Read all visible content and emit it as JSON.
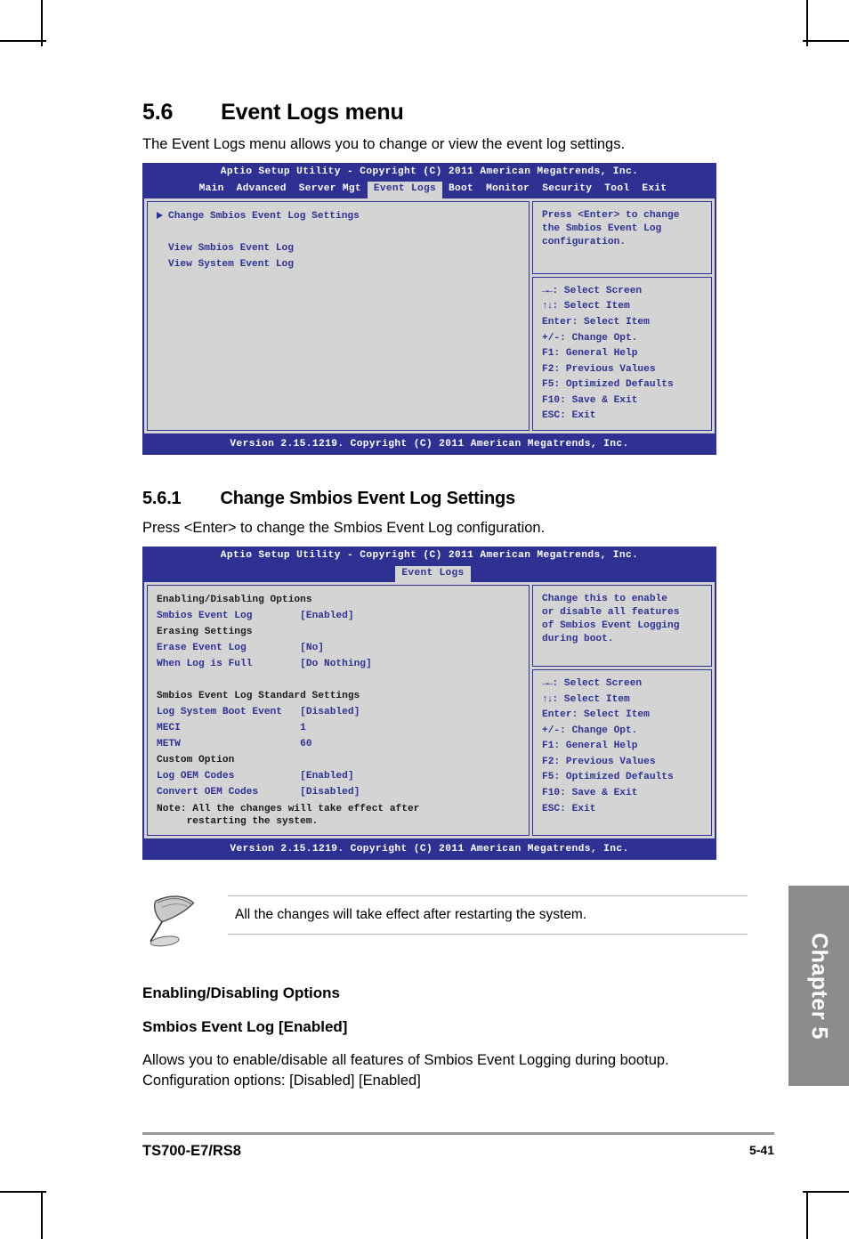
{
  "document": {
    "section": {
      "number": "5.6",
      "title": "Event Logs menu"
    },
    "section_intro": "The Event Logs menu allows you to change or view the event log settings.",
    "subsection": {
      "number": "5.6.1",
      "title": "Change Smbios Event Log Settings"
    },
    "subsection_intro": "Press <Enter> to change the Smbios Event Log configuration.",
    "note_callout": "All the changes will take effect after restarting the system.",
    "lower": {
      "group_heading": "Enabling/Disabling Options",
      "item_heading": "Smbios Event Log [Enabled]",
      "item_body": "Allows you  to enable/disable all features of Smbios Event Logging during bootup. Configuration options: [Disabled] [Enabled]"
    },
    "footer": {
      "model": "TS700-E7/RS8",
      "page": "5-41"
    },
    "chapter_tab": "Chapter 5",
    "colors": {
      "bios_blue": "#2e3192",
      "bios_gray": "#d4d4d4",
      "chapter_gray": "#8c8c8c"
    }
  },
  "bios1": {
    "title": "Aptio Setup Utility - Copyright (C) 2011 American Megatrends, Inc.",
    "tabs": [
      {
        "label": "Main",
        "active": false
      },
      {
        "label": "Advanced",
        "active": false
      },
      {
        "label": "Server Mgt",
        "active": false
      },
      {
        "label": "Event Logs",
        "active": true
      },
      {
        "label": "Boot",
        "active": false
      },
      {
        "label": "Monitor",
        "active": false
      },
      {
        "label": "Security",
        "active": false
      },
      {
        "label": "Tool",
        "active": false
      },
      {
        "label": "Exit",
        "active": false
      }
    ],
    "items": [
      {
        "type": "submenu",
        "label": "Change Smbios Event Log Settings"
      },
      {
        "type": "spacer",
        "label": ""
      },
      {
        "type": "link",
        "label": "View Smbios Event Log"
      },
      {
        "type": "link",
        "label": "View System Event Log"
      }
    ],
    "help": "Press <Enter> to change\nthe Smbios Event Log\nconfiguration.",
    "legend": [
      {
        "keys": "→←",
        "text": ": Select Screen"
      },
      {
        "keys": "↑↓",
        "text": ": Select Item"
      },
      {
        "keys": "",
        "text": "Enter: Select Item"
      },
      {
        "keys": "",
        "text": "+/-: Change Opt."
      },
      {
        "keys": "",
        "text": "F1: General Help"
      },
      {
        "keys": "",
        "text": "F2: Previous Values"
      },
      {
        "keys": "",
        "text": "F5: Optimized Defaults"
      },
      {
        "keys": "",
        "text": "F10: Save & Exit"
      },
      {
        "keys": "",
        "text": "ESC: Exit"
      }
    ],
    "footer": "Version 2.15.1219. Copyright (C) 2011 American Megatrends, Inc."
  },
  "bios2": {
    "title": "Aptio Setup Utility - Copyright (C) 2011 American Megatrends, Inc.",
    "tabs": [
      {
        "label": "Event Logs",
        "active": true
      }
    ],
    "items": [
      {
        "type": "group",
        "label": "Enabling/Disabling Options",
        "value": ""
      },
      {
        "type": "option",
        "label": "Smbios Event Log",
        "value": "[Enabled]"
      },
      {
        "type": "group",
        "label": "Erasing Settings",
        "value": ""
      },
      {
        "type": "option",
        "label": "Erase Event Log",
        "value": "[No]"
      },
      {
        "type": "option",
        "label": "When Log is Full",
        "value": "[Do Nothing]"
      },
      {
        "type": "spacer",
        "label": "",
        "value": ""
      },
      {
        "type": "group",
        "label": "Smbios Event Log Standard Settings",
        "value": ""
      },
      {
        "type": "option",
        "label": "Log System Boot Event",
        "value": "[Disabled]"
      },
      {
        "type": "option",
        "label": "MECI",
        "value": "1"
      },
      {
        "type": "option",
        "label": "METW",
        "value": "60"
      },
      {
        "type": "group",
        "label": "Custom Option",
        "value": ""
      },
      {
        "type": "option",
        "label": "Log OEM Codes",
        "value": "[Enabled]"
      },
      {
        "type": "option",
        "label": "Convert OEM Codes",
        "value": "[Disabled]"
      }
    ],
    "note": "Note: All the changes will take effect after\n     restarting the system.",
    "help": "Change this to enable\nor disable all features\nof Smbios Event Logging\nduring boot.",
    "legend": [
      {
        "keys": "→←",
        "text": ": Select Screen"
      },
      {
        "keys": "↑↓",
        "text": ": Select Item"
      },
      {
        "keys": "",
        "text": "Enter: Select Item"
      },
      {
        "keys": "",
        "text": "+/-: Change Opt."
      },
      {
        "keys": "",
        "text": "F1: General Help"
      },
      {
        "keys": "",
        "text": "F2: Previous Values"
      },
      {
        "keys": "",
        "text": "F5: Optimized Defaults"
      },
      {
        "keys": "",
        "text": "F10: Save & Exit"
      },
      {
        "keys": "",
        "text": "ESC: Exit"
      }
    ],
    "footer": "Version 2.15.1219. Copyright (C) 2011 American Megatrends, Inc."
  }
}
